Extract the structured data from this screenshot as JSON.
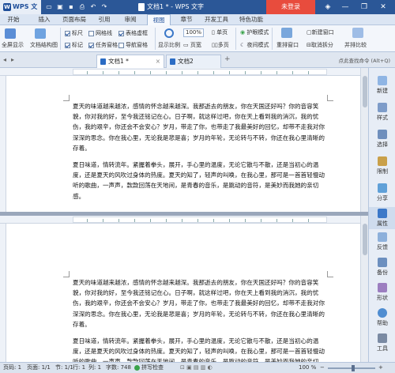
{
  "titlebar": {
    "brand": "WPS 文字",
    "logo": "W",
    "window_title": "文档1 * - WPS 文字",
    "login": "未登录",
    "minimize": "—",
    "restore": "❐",
    "close": "✕"
  },
  "menu": {
    "tabs": [
      "开始",
      "插入",
      "页面布局",
      "引用",
      "审阅",
      "视图",
      "章节",
      "开发工具",
      "特色功能"
    ],
    "active": "视图"
  },
  "ribbon": {
    "fullscreen_label": "全屏显示",
    "docstruct_label": "文档结构图",
    "ruler": "标尺",
    "gridlines": "网格线",
    "table_grid": "表格虚框",
    "marks": "标记",
    "taskpane": "任务窗格",
    "nav_window": "导航窗格",
    "display_ratio": "显示比例",
    "zoom_value": "100%",
    "single_page": "单页",
    "page_width": "页宽",
    "multi_page": "多页",
    "eye_mode": "护眼模式",
    "night_mode": "夜间模式",
    "rearrange": "重排窗口",
    "new_window": "新建窗口",
    "cancel_split": "取消拆分",
    "side_by_side": "并排比较"
  },
  "doctabs": {
    "tabs": [
      "文档1 *",
      "文档2"
    ],
    "search_hint": "点此查找命令 (Alt+Q)"
  },
  "document": {
    "paragraphs": [
      "夏天的味道越来越浓，感情的怀念越来越深。我那逝去的朋友，你在天国还好吗？你的音容笑貌，你对我的好，至今我还铭记在心。日子啊，就这样过吧，你在天上看到我的消沉，我的忧伤，我的艰辛，你还会不会安心？岁月，带走了你，也带走了我最美好的回忆，却带不走我对你深深的思念。你在我心里，无论我是悲是喜；岁月的年轮，无论转与不转，你还在我心里清晰的存着。",
      "夏日味道，情转流年。紧握着拳头，展开，手心里的温度，无论它散与不散，还是当初心的温度，还是夏天的风吹过身体的热度。夏天的知了，轻声的叫唤，在我心里，那可是一首首轻慢动听的歌曲，一声声，款款回荡在天地间，是青春的音乐，是跳动的音符，是美妙而我她的亲切感。"
    ]
  },
  "sidepanel": {
    "items": [
      "新建",
      "样式",
      "选择",
      "限制",
      "分享",
      "属性",
      "反馈",
      "备份",
      "形状",
      "帮助",
      "工具"
    ],
    "active": "属性"
  },
  "statusbar": {
    "page": "页码: 1",
    "pages": "页面: 1/1",
    "section": "节: 1/1",
    "line": "行: 1",
    "column": "列: 1",
    "wordcount": "字数: 748",
    "spellcheck": "拼写检查",
    "zoom": "100 %"
  },
  "colors": {
    "titlebar": "#2b5797",
    "login": "#e84c3d",
    "accent": "#1e4e9a"
  }
}
